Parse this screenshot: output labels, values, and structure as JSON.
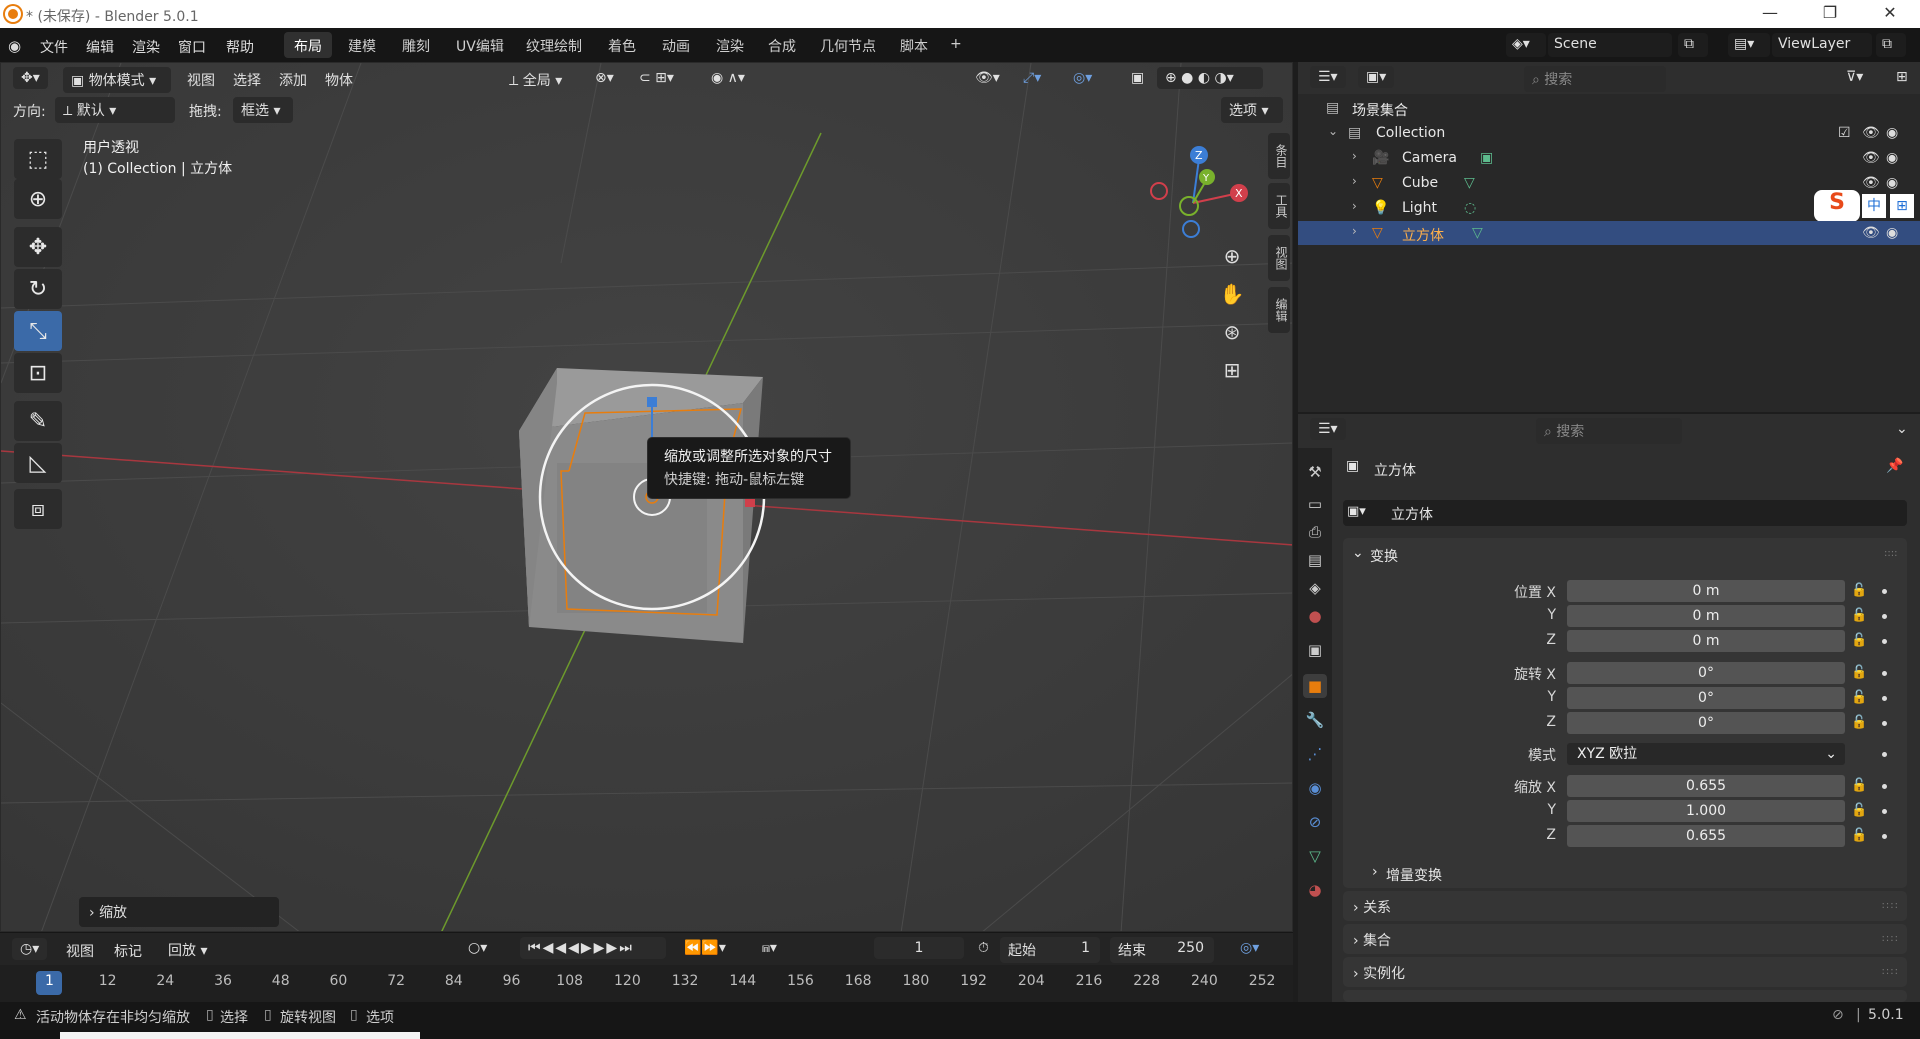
{
  "window": {
    "title": "* (未保存) - Blender 5.0.1",
    "min": "—",
    "max": "❐",
    "close": "✕"
  },
  "menu": [
    "文件",
    "编辑",
    "渲染",
    "窗口",
    "帮助"
  ],
  "workspaces": [
    "布局",
    "建模",
    "雕刻",
    "UV编辑",
    "纹理绘制",
    "着色",
    "动画",
    "渲染",
    "合成",
    "几何节点",
    "脚本"
  ],
  "active_workspace": "布局",
  "scene": "Scene",
  "view_layer": "ViewLayer",
  "viewport_header": {
    "mode": "物体模式",
    "items": [
      "视图",
      "选择",
      "添加",
      "物体"
    ],
    "transform_orientation": "全局",
    "orientation_label": "方向:",
    "orientation_value": "默认",
    "drag_label": "拖拽:",
    "drag_value": "框选",
    "options": "选项"
  },
  "viewport": {
    "view_name": "用户透视",
    "collection_info": "(1) Collection | 立方体",
    "tooltip_title": "缩放或调整所选对象的尺寸",
    "tooltip_shortcut": "快捷键: 拖动-鼠标左键",
    "last_operator": "缩放",
    "side_tabs": [
      "条目",
      "工具",
      "视图",
      "编辑"
    ],
    "gizmo": {
      "x": "X",
      "y": "Y",
      "z": "Z"
    }
  },
  "timeline": {
    "menu": [
      "视图",
      "标记"
    ],
    "playback": "回放",
    "current_frame": "1",
    "start_label": "起始",
    "start": "1",
    "end_label": "结束",
    "end": "250",
    "frames": [
      "1",
      "12",
      "24",
      "36",
      "48",
      "60",
      "72",
      "84",
      "96",
      "108",
      "120",
      "132",
      "144",
      "156",
      "168",
      "180",
      "192",
      "204",
      "216",
      "228",
      "240",
      "252"
    ]
  },
  "status": {
    "warning": "活动物体存在非均匀缩放",
    "select": "选择",
    "rotate": "旋转视图",
    "options": "选项",
    "version": "5.0.1"
  },
  "outliner": {
    "search_placeholder": "搜索",
    "scene_collection": "场景集合",
    "collection": "Collection",
    "items": [
      {
        "name": "Camera"
      },
      {
        "name": "Cube"
      },
      {
        "name": "Light"
      },
      {
        "name": "立方体",
        "selected": true
      }
    ]
  },
  "properties": {
    "search_placeholder": "搜索",
    "object_name_header": "立方体",
    "object_name_field": "立方体",
    "transform": {
      "title": "变换",
      "location_label": "位置 X",
      "location": [
        "0 m",
        "0 m",
        "0 m"
      ],
      "rotation_label": "旋转 X",
      "rotation": [
        "0°",
        "0°",
        "0°"
      ],
      "mode_label": "模式",
      "mode": "XYZ 欧拉",
      "scale_label": "缩放 X",
      "scale": [
        "0.655",
        "1.000",
        "0.655"
      ],
      "y": "Y",
      "z": "Z",
      "delta": "增量变换"
    },
    "sections": [
      "关系",
      "集合",
      "实例化"
    ]
  },
  "colors": {
    "accent": "#3b6aa8",
    "selected_row": "#334d80",
    "orange": "#e87d0d",
    "x_axis": "#d13f4b",
    "y_axis": "#79b12c",
    "z_axis": "#3c7ed6"
  }
}
